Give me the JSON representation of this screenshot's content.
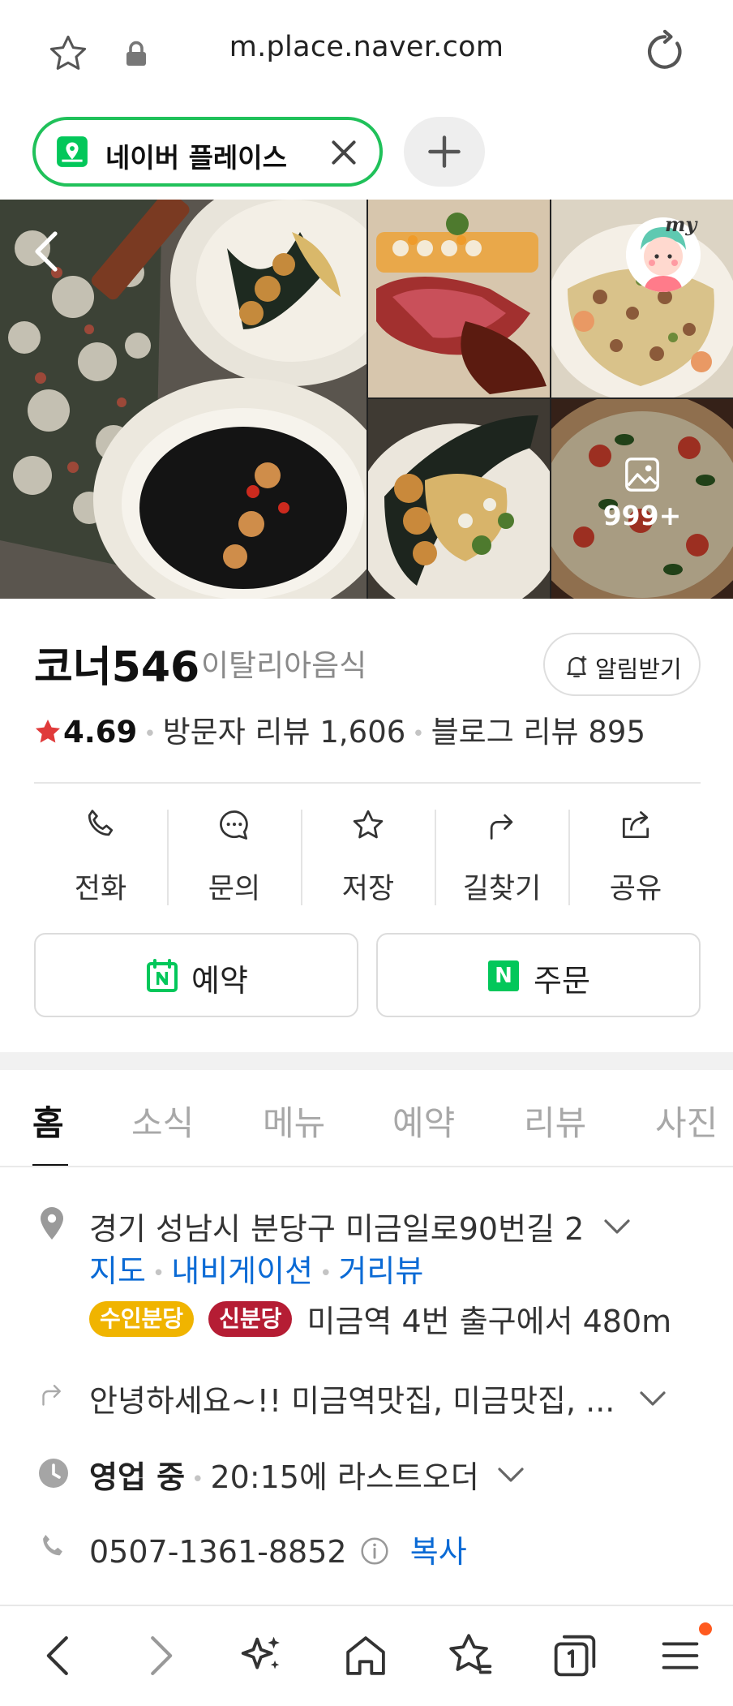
{
  "browser": {
    "url": "m.place.naver.com",
    "tab_label": "네이버 플레이스"
  },
  "photos": {
    "count_label": "999+",
    "profile_badge": "my"
  },
  "place": {
    "name": "코너546",
    "category": "이탈리아음식",
    "alarm_label": "알림받기",
    "rating": "4.69",
    "visitor_reviews": "방문자 리뷰 1,606",
    "blog_reviews": "블로그 리뷰 895"
  },
  "actions": [
    {
      "label": "전화",
      "icon": "phone-icon"
    },
    {
      "label": "문의",
      "icon": "chat-icon"
    },
    {
      "label": "저장",
      "icon": "star-icon"
    },
    {
      "label": "길찾기",
      "icon": "directions-icon"
    },
    {
      "label": "공유",
      "icon": "share-icon"
    }
  ],
  "buttons": {
    "reserve": "예약",
    "order": "주문",
    "naver_mark": "N"
  },
  "tabs": [
    "홈",
    "소식",
    "메뉴",
    "예약",
    "리뷰",
    "사진"
  ],
  "info": {
    "address": "경기 성남시 분당구 미금일로90번길 2",
    "links": [
      "지도",
      "내비게이션",
      "거리뷰"
    ],
    "subway_badges": [
      {
        "label": "수인분당",
        "color": "#f0b400"
      },
      {
        "label": "신분당",
        "color": "#b51d34"
      }
    ],
    "subway_text": "미금역 4번 출구에서 480m",
    "description": "안녕하세요~!! 미금역맛집, 미금맛집, ...",
    "status": "영업 중",
    "status_detail": "20:15에 라스트오더",
    "phone": "0507-1361-8852",
    "copy_label": "복사"
  },
  "colors": {
    "naver_green": "#03c75a",
    "rating_star": "#e03a3a",
    "link_blue": "#0a6ad5"
  }
}
